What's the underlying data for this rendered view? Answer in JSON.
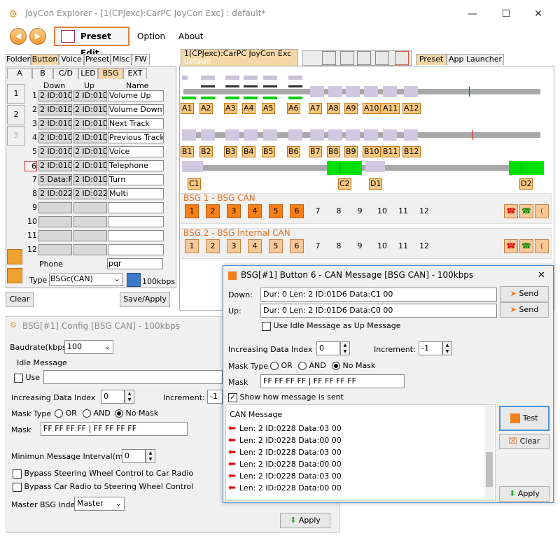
{
  "window": {
    "title": "JoyCon Explorer - [1(CPJexc):CarPC JoyCon Exc] : default*",
    "minimize": "—",
    "maximize": "☐",
    "close": "✕"
  },
  "toolbar": {
    "back": "◀",
    "forward": "▶",
    "preset_edit": "Preset Edit",
    "option": "Option",
    "about": "About"
  },
  "left_tabs": [
    "Folder",
    "Button",
    "Voice",
    "Preset",
    "Misc",
    "FW"
  ],
  "sub_tabs": [
    "A",
    "B",
    "C/D",
    "LED",
    "BSG",
    "EXT"
  ],
  "side_tabs": [
    "1",
    "2",
    "3"
  ],
  "table": {
    "headers": [
      "Down",
      "Up",
      "Name"
    ],
    "rows": [
      {
        "n": "1",
        "down": "2 ID:01D6",
        "up": "2 ID:01D6",
        "name": "Volume Up"
      },
      {
        "n": "2",
        "down": "2 ID:01D6",
        "up": "2 ID:01D6",
        "name": "Volume Down"
      },
      {
        "n": "3",
        "down": "2 ID:01D6",
        "up": "2 ID:01D6",
        "name": "Next Track"
      },
      {
        "n": "4",
        "down": "2 ID:01D6",
        "up": "2 ID:01D6",
        "name": "Previous Track"
      },
      {
        "n": "5",
        "down": "2 ID:01D6",
        "up": "2 ID:01D6",
        "name": "Voice"
      },
      {
        "n": "6",
        "down": "2 ID:01D6",
        "up": "2 ID:01D6",
        "name": "Telephone"
      },
      {
        "n": "7",
        "down": "5 Data:F:",
        "up": "2 ID:01D6",
        "name": "Turn"
      },
      {
        "n": "8",
        "down": "2 ID:0228",
        "up": "2 ID:0228",
        "name": "Multi"
      },
      {
        "n": "9",
        "down": "",
        "up": "",
        "name": ""
      },
      {
        "n": "10",
        "down": "",
        "up": "",
        "name": ""
      },
      {
        "n": "11",
        "down": "",
        "up": "",
        "name": ""
      },
      {
        "n": "12",
        "down": "",
        "up": "",
        "name": ""
      }
    ],
    "phone_label": "Phone",
    "phone_value": "pqr",
    "type_label": "Type",
    "type_value": "BSGc(CAN)",
    "speed": "100kbps"
  },
  "left_buttons": {
    "clear": "Clear",
    "save_apply": "Save/Apply"
  },
  "right_tabs": {
    "device": "1(CPJexc):CarPC JoyCon Exc",
    "device_sub": "default",
    "preset": "Preset",
    "app_launcher": "App Launcher"
  },
  "tracks": {
    "a": [
      "A1",
      "A2",
      "A3",
      "A4",
      "A5",
      "A6",
      "A7",
      "A8",
      "A9",
      "A10",
      "A11",
      "A12"
    ],
    "b": [
      "B1",
      "B2",
      "B3",
      "B4",
      "B5",
      "B6",
      "B7",
      "B8",
      "B9",
      "B10",
      "B11",
      "B12"
    ],
    "cd": [
      "C1",
      "C2",
      "D1",
      "D2"
    ]
  },
  "bsg1": {
    "title": "BSG 1 - BSG CAN",
    "buttons": [
      "1",
      "2",
      "3",
      "4",
      "5",
      "6",
      "7",
      "8",
      "9",
      "10",
      "11",
      "12"
    ]
  },
  "bsg2": {
    "title": "BSG 2 - BSG Internal CAN",
    "buttons": [
      "1",
      "2",
      "3",
      "4",
      "5",
      "6",
      "7",
      "8",
      "9",
      "10",
      "11",
      "12"
    ]
  },
  "config": {
    "title": "BSG[#1] Config [BSG CAN] - 100kbps",
    "baudrate_label": "Baudrate(kbps)",
    "baudrate": "100",
    "idle_group": "Idle Message",
    "use_label": "Use",
    "inc_index_label": "Increasing Data Index",
    "inc_index": "0",
    "increment_label": "Increment:",
    "increment": "-1",
    "mask_type_label": "Mask Type",
    "or": "OR",
    "and": "AND",
    "no_mask": "No Mask",
    "mask_label": "Mask",
    "mask": "FF FF FF FF | FF FF FF FF",
    "min_interval_label": "Minimun Message Interval(ms)",
    "min_interval": "0",
    "bypass1": "Bypass Steering Wheel Control to Car Radio",
    "bypass2": "Bypass Car Radio to Steering Wheel Control",
    "master_label": "Master BSG Index",
    "master": "Master",
    "apply": "Apply"
  },
  "dialog": {
    "title": "BSG[#1] Button 6 - CAN Message [BSG CAN] - 100kbps",
    "down_label": "Down:",
    "down": "Dur:  0 Len: 2 ID:01D6 Data:C1 00",
    "up_label": "Up:",
    "up": "Dur:  0 Len: 2 ID:01D6 Data:C0 00",
    "send": "Send",
    "use_idle": "Use Idle Message as Up Message",
    "inc_index_label": "Increasing Data Index",
    "inc_index": "0",
    "increment_label": "Increment:",
    "increment": "-1",
    "mask_type_label": "Mask Type",
    "or": "OR",
    "and": "AND",
    "no_mask": "No Mask",
    "mask_label": "Mask",
    "mask": "FF FF FF FF | FF FF FF FF",
    "show_label": "Show how message is sent",
    "can_header": "CAN Message",
    "can_rows": [
      "Len: 2 ID:0228 Data:03 00",
      "Len: 2 ID:0228 Data:00 00",
      "Len: 2 ID:0228 Data:03 00",
      "Len: 2 ID:0228 Data:00 00",
      "Len: 2 ID:0228 Data:03 00",
      "Len: 2 ID:0228 Data:00 00"
    ],
    "test": "Test",
    "clear": "Clear",
    "apply": "Apply",
    "close": "✕"
  }
}
